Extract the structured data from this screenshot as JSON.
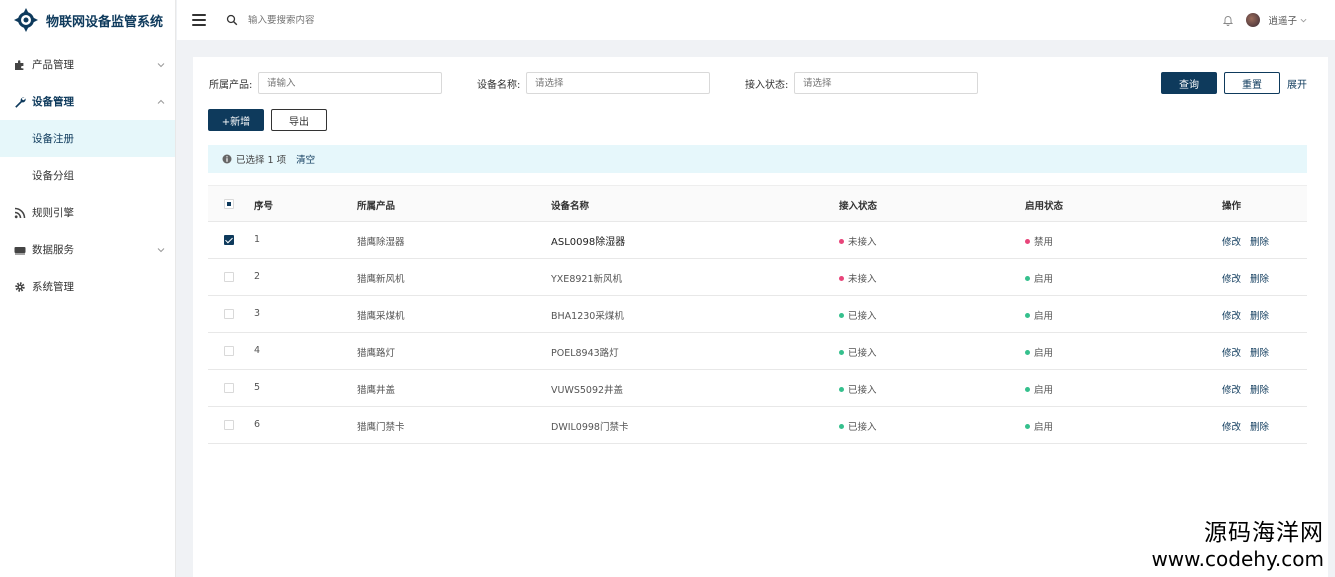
{
  "app": {
    "title": "物联网设备监管系统"
  },
  "sidebar": {
    "items": [
      {
        "label": "产品管理",
        "icon": "puzzle-icon",
        "arrow": "down"
      },
      {
        "label": "设备管理",
        "icon": "wrench-icon",
        "arrow": "up"
      },
      {
        "label": "设备注册"
      },
      {
        "label": "设备分组"
      },
      {
        "label": "规则引擎",
        "icon": "rss-icon"
      },
      {
        "label": "数据服务",
        "icon": "keyboard-icon",
        "arrow": "down"
      },
      {
        "label": "系统管理",
        "icon": "gear-icon"
      }
    ]
  },
  "header": {
    "search_placeholder": "输入要搜索内容",
    "username": "逍遥子"
  },
  "filters": {
    "product_label": "所属产品:",
    "product_placeholder": "请输入",
    "device_label": "设备名称:",
    "device_placeholder": "请选择",
    "access_label": "接入状态:",
    "access_placeholder": "请选择",
    "query_label": "查询",
    "reset_label": "重置",
    "expand_label": "展开"
  },
  "toolbar": {
    "add_label": "+新增",
    "export_label": "导出"
  },
  "alert": {
    "text": "已选择 1 项",
    "clear_label": "清空"
  },
  "table": {
    "columns": [
      "序号",
      "所属产品",
      "设备名称",
      "接入状态",
      "启用状态",
      "操作"
    ],
    "edit_label": "修改",
    "delete_label": "删除",
    "rows": [
      {
        "no": "1",
        "product": "猎鹰除湿器",
        "name": "ASL0098除湿器",
        "access": "未接入",
        "enable": "禁用",
        "checked": true
      },
      {
        "no": "2",
        "product": "猎鹰新风机",
        "name": "YXE8921新风机",
        "access": "未接入",
        "enable": "启用",
        "checked": false
      },
      {
        "no": "3",
        "product": "猎鹰采煤机",
        "name": "BHA1230采煤机",
        "access": "已接入",
        "enable": "启用",
        "checked": false
      },
      {
        "no": "4",
        "product": "猎鹰路灯",
        "name": "POEL8943路灯",
        "access": "已接入",
        "enable": "启用",
        "checked": false
      },
      {
        "no": "5",
        "product": "猎鹰井盖",
        "name": "VUWS5092井盖",
        "access": "已接入",
        "enable": "启用",
        "checked": false
      },
      {
        "no": "6",
        "product": "猎鹰门禁卡",
        "name": "DWIL0998门禁卡",
        "access": "已接入",
        "enable": "启用",
        "checked": false
      }
    ]
  },
  "colors": {
    "brand": "#0e3a5c",
    "status_off": "#e8457a",
    "status_on": "#35c08d",
    "alert_bg": "#e6f7fb"
  },
  "watermark": {
    "line1": "源码海洋网",
    "line2": "www.codehy.com"
  }
}
